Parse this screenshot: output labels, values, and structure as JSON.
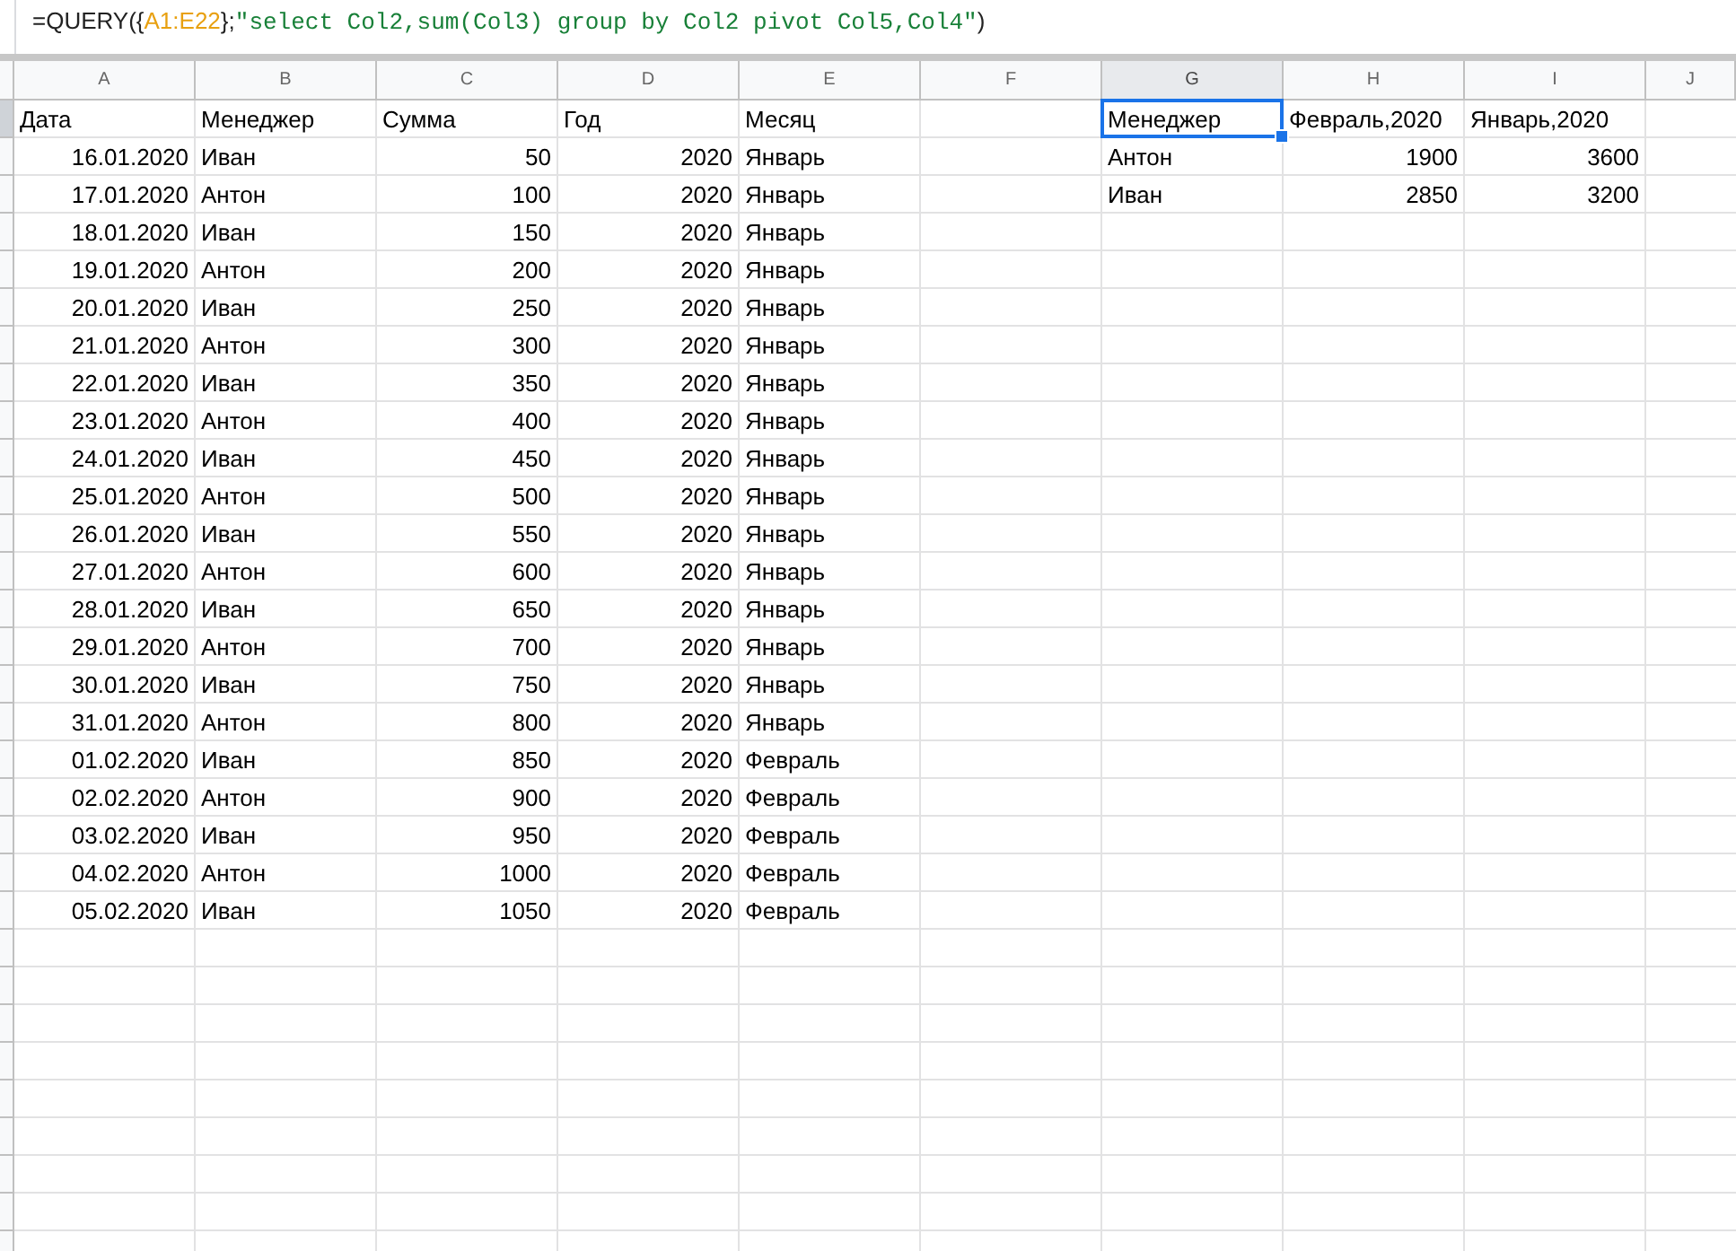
{
  "formula_bar": {
    "segments": [
      {
        "text": "=QUERY({",
        "kind": "plain"
      },
      {
        "text": "A1:E22",
        "kind": "range"
      },
      {
        "text": "};",
        "kind": "plain"
      },
      {
        "text": "\"select Col2,sum(Col3) group by Col2 pivot Col5,Col4\"",
        "kind": "string"
      },
      {
        "text": ")",
        "kind": "plain"
      }
    ]
  },
  "columns": [
    {
      "label": "A",
      "selected": false
    },
    {
      "label": "B",
      "selected": false
    },
    {
      "label": "C",
      "selected": false
    },
    {
      "label": "D",
      "selected": false
    },
    {
      "label": "E",
      "selected": false
    },
    {
      "label": "F",
      "selected": false
    },
    {
      "label": "G",
      "selected": true
    },
    {
      "label": "H",
      "selected": false
    },
    {
      "label": "I",
      "selected": false
    },
    {
      "label": "J",
      "selected": false
    }
  ],
  "rows": [
    {
      "selected": true,
      "cells": [
        {
          "text": "Дата",
          "kind": "text"
        },
        {
          "text": "Менеджер",
          "kind": "text"
        },
        {
          "text": "Сумма",
          "kind": "text"
        },
        {
          "text": "Год",
          "kind": "text"
        },
        {
          "text": "Месяц",
          "kind": "text"
        },
        null,
        {
          "text": "Менеджер",
          "kind": "text"
        },
        {
          "text": "Февраль,2020",
          "kind": "text"
        },
        {
          "text": "Январь,2020",
          "kind": "text"
        }
      ]
    },
    {
      "selected": false,
      "cells": [
        {
          "text": "16.01.2020",
          "kind": "number"
        },
        {
          "text": "Иван",
          "kind": "text"
        },
        {
          "text": "50",
          "kind": "number"
        },
        {
          "text": "2020",
          "kind": "number"
        },
        {
          "text": "Январь",
          "kind": "text"
        },
        null,
        {
          "text": "Антон",
          "kind": "text"
        },
        {
          "text": "1900",
          "kind": "number"
        },
        {
          "text": "3600",
          "kind": "number"
        }
      ]
    },
    {
      "selected": false,
      "cells": [
        {
          "text": "17.01.2020",
          "kind": "number"
        },
        {
          "text": "Антон",
          "kind": "text"
        },
        {
          "text": "100",
          "kind": "number"
        },
        {
          "text": "2020",
          "kind": "number"
        },
        {
          "text": "Январь",
          "kind": "text"
        },
        null,
        {
          "text": "Иван",
          "kind": "text"
        },
        {
          "text": "2850",
          "kind": "number"
        },
        {
          "text": "3200",
          "kind": "number"
        }
      ]
    },
    {
      "selected": false,
      "cells": [
        {
          "text": "18.01.2020",
          "kind": "number"
        },
        {
          "text": "Иван",
          "kind": "text"
        },
        {
          "text": "150",
          "kind": "number"
        },
        {
          "text": "2020",
          "kind": "number"
        },
        {
          "text": "Январь",
          "kind": "text"
        }
      ]
    },
    {
      "selected": false,
      "cells": [
        {
          "text": "19.01.2020",
          "kind": "number"
        },
        {
          "text": "Антон",
          "kind": "text"
        },
        {
          "text": "200",
          "kind": "number"
        },
        {
          "text": "2020",
          "kind": "number"
        },
        {
          "text": "Январь",
          "kind": "text"
        }
      ]
    },
    {
      "selected": false,
      "cells": [
        {
          "text": "20.01.2020",
          "kind": "number"
        },
        {
          "text": "Иван",
          "kind": "text"
        },
        {
          "text": "250",
          "kind": "number"
        },
        {
          "text": "2020",
          "kind": "number"
        },
        {
          "text": "Январь",
          "kind": "text"
        }
      ]
    },
    {
      "selected": false,
      "cells": [
        {
          "text": "21.01.2020",
          "kind": "number"
        },
        {
          "text": "Антон",
          "kind": "text"
        },
        {
          "text": "300",
          "kind": "number"
        },
        {
          "text": "2020",
          "kind": "number"
        },
        {
          "text": "Январь",
          "kind": "text"
        }
      ]
    },
    {
      "selected": false,
      "cells": [
        {
          "text": "22.01.2020",
          "kind": "number"
        },
        {
          "text": "Иван",
          "kind": "text"
        },
        {
          "text": "350",
          "kind": "number"
        },
        {
          "text": "2020",
          "kind": "number"
        },
        {
          "text": "Январь",
          "kind": "text"
        }
      ]
    },
    {
      "selected": false,
      "cells": [
        {
          "text": "23.01.2020",
          "kind": "number"
        },
        {
          "text": "Антон",
          "kind": "text"
        },
        {
          "text": "400",
          "kind": "number"
        },
        {
          "text": "2020",
          "kind": "number"
        },
        {
          "text": "Январь",
          "kind": "text"
        }
      ]
    },
    {
      "selected": false,
      "cells": [
        {
          "text": "24.01.2020",
          "kind": "number"
        },
        {
          "text": "Иван",
          "kind": "text"
        },
        {
          "text": "450",
          "kind": "number"
        },
        {
          "text": "2020",
          "kind": "number"
        },
        {
          "text": "Январь",
          "kind": "text"
        }
      ]
    },
    {
      "selected": false,
      "cells": [
        {
          "text": "25.01.2020",
          "kind": "number"
        },
        {
          "text": "Антон",
          "kind": "text"
        },
        {
          "text": "500",
          "kind": "number"
        },
        {
          "text": "2020",
          "kind": "number"
        },
        {
          "text": "Январь",
          "kind": "text"
        }
      ]
    },
    {
      "selected": false,
      "cells": [
        {
          "text": "26.01.2020",
          "kind": "number"
        },
        {
          "text": "Иван",
          "kind": "text"
        },
        {
          "text": "550",
          "kind": "number"
        },
        {
          "text": "2020",
          "kind": "number"
        },
        {
          "text": "Январь",
          "kind": "text"
        }
      ]
    },
    {
      "selected": false,
      "cells": [
        {
          "text": "27.01.2020",
          "kind": "number"
        },
        {
          "text": "Антон",
          "kind": "text"
        },
        {
          "text": "600",
          "kind": "number"
        },
        {
          "text": "2020",
          "kind": "number"
        },
        {
          "text": "Январь",
          "kind": "text"
        }
      ]
    },
    {
      "selected": false,
      "cells": [
        {
          "text": "28.01.2020",
          "kind": "number"
        },
        {
          "text": "Иван",
          "kind": "text"
        },
        {
          "text": "650",
          "kind": "number"
        },
        {
          "text": "2020",
          "kind": "number"
        },
        {
          "text": "Январь",
          "kind": "text"
        }
      ]
    },
    {
      "selected": false,
      "cells": [
        {
          "text": "29.01.2020",
          "kind": "number"
        },
        {
          "text": "Антон",
          "kind": "text"
        },
        {
          "text": "700",
          "kind": "number"
        },
        {
          "text": "2020",
          "kind": "number"
        },
        {
          "text": "Январь",
          "kind": "text"
        }
      ]
    },
    {
      "selected": false,
      "cells": [
        {
          "text": "30.01.2020",
          "kind": "number"
        },
        {
          "text": "Иван",
          "kind": "text"
        },
        {
          "text": "750",
          "kind": "number"
        },
        {
          "text": "2020",
          "kind": "number"
        },
        {
          "text": "Январь",
          "kind": "text"
        }
      ]
    },
    {
      "selected": false,
      "cells": [
        {
          "text": "31.01.2020",
          "kind": "number"
        },
        {
          "text": "Антон",
          "kind": "text"
        },
        {
          "text": "800",
          "kind": "number"
        },
        {
          "text": "2020",
          "kind": "number"
        },
        {
          "text": "Январь",
          "kind": "text"
        }
      ]
    },
    {
      "selected": false,
      "cells": [
        {
          "text": "01.02.2020",
          "kind": "number"
        },
        {
          "text": "Иван",
          "kind": "text"
        },
        {
          "text": "850",
          "kind": "number"
        },
        {
          "text": "2020",
          "kind": "number"
        },
        {
          "text": "Февраль",
          "kind": "text"
        }
      ]
    },
    {
      "selected": false,
      "cells": [
        {
          "text": "02.02.2020",
          "kind": "number"
        },
        {
          "text": "Антон",
          "kind": "text"
        },
        {
          "text": "900",
          "kind": "number"
        },
        {
          "text": "2020",
          "kind": "number"
        },
        {
          "text": "Февраль",
          "kind": "text"
        }
      ]
    },
    {
      "selected": false,
      "cells": [
        {
          "text": "03.02.2020",
          "kind": "number"
        },
        {
          "text": "Иван",
          "kind": "text"
        },
        {
          "text": "950",
          "kind": "number"
        },
        {
          "text": "2020",
          "kind": "number"
        },
        {
          "text": "Февраль",
          "kind": "text"
        }
      ]
    },
    {
      "selected": false,
      "cells": [
        {
          "text": "04.02.2020",
          "kind": "number"
        },
        {
          "text": "Антон",
          "kind": "text"
        },
        {
          "text": "1000",
          "kind": "number"
        },
        {
          "text": "2020",
          "kind": "number"
        },
        {
          "text": "Февраль",
          "kind": "text"
        }
      ]
    },
    {
      "selected": false,
      "cells": [
        {
          "text": "05.02.2020",
          "kind": "number"
        },
        {
          "text": "Иван",
          "kind": "text"
        },
        {
          "text": "1050",
          "kind": "number"
        },
        {
          "text": "2020",
          "kind": "number"
        },
        {
          "text": "Февраль",
          "kind": "text"
        }
      ]
    }
  ]
}
